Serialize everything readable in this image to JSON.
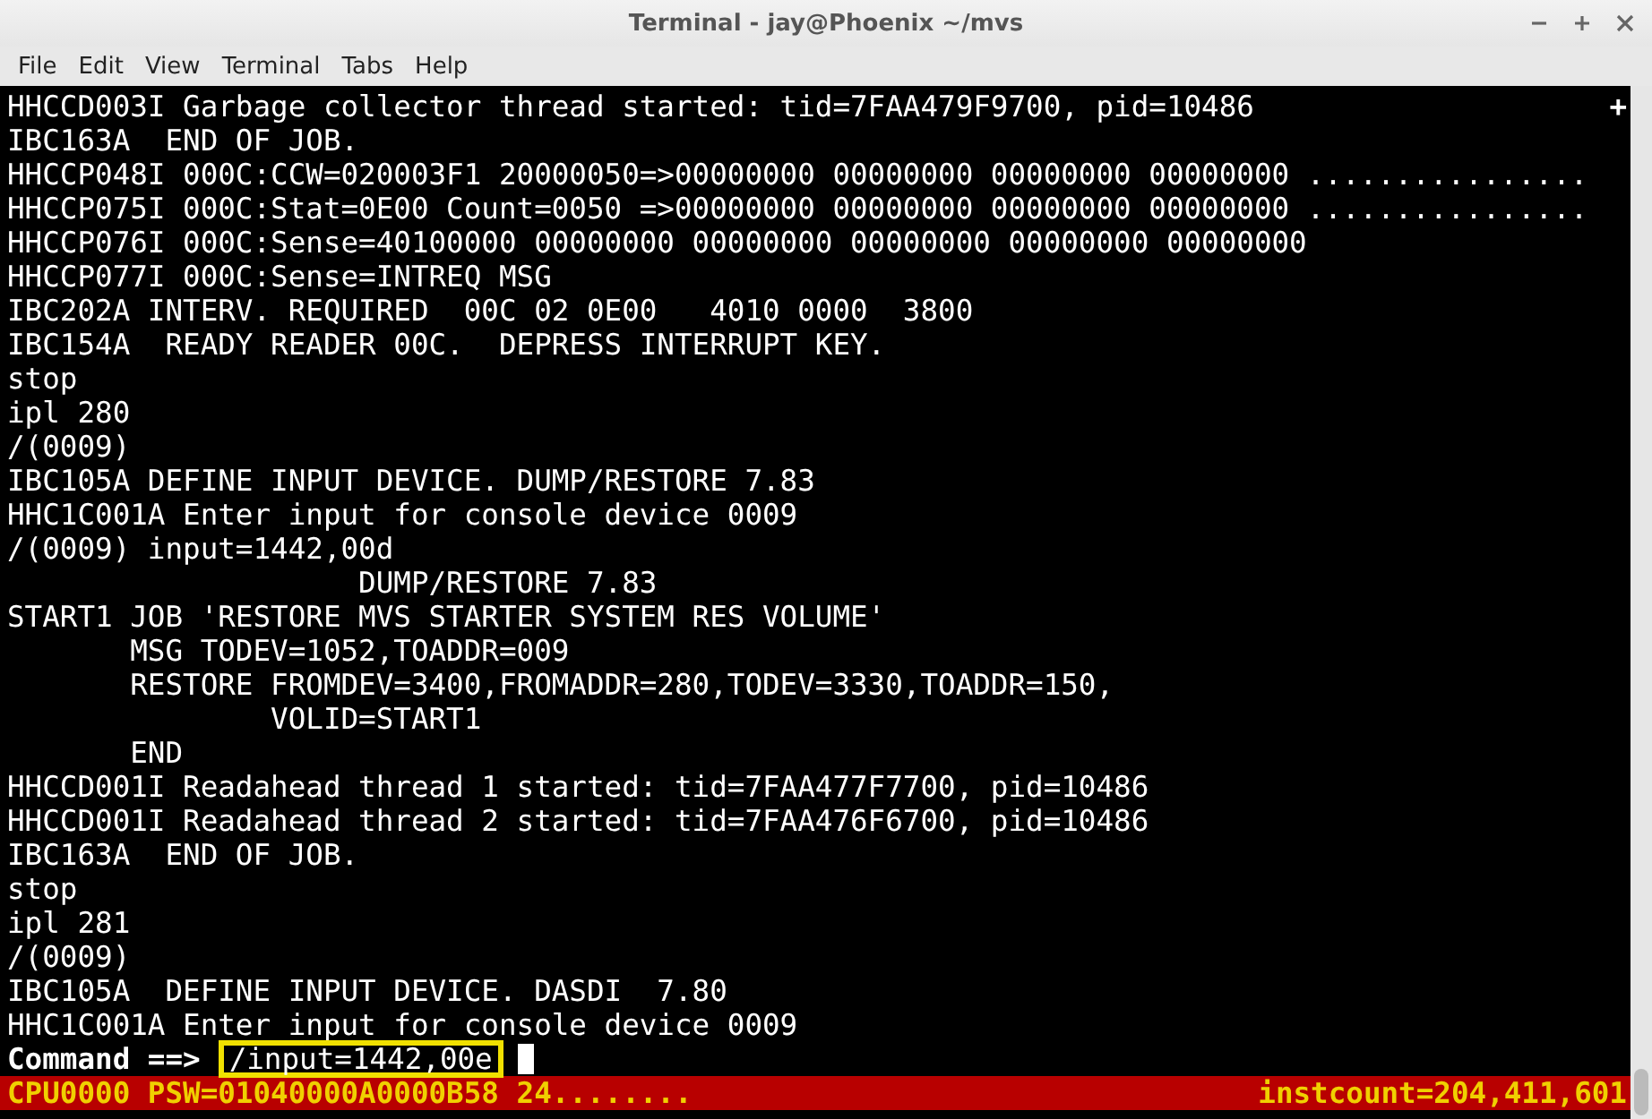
{
  "window": {
    "title": "Terminal - jay@Phoenix ~/mvs"
  },
  "menu": [
    "File",
    "Edit",
    "View",
    "Terminal",
    "Tabs",
    "Help"
  ],
  "terminal": {
    "marker": "+",
    "lines": [
      "HHCCD003I Garbage collector thread started: tid=7FAA479F9700, pid=10486",
      "IBC163A  END OF JOB.",
      "HHCCP048I 000C:CCW=020003F1 20000050=>00000000 00000000 00000000 00000000 ................",
      "HHCCP075I 000C:Stat=0E00 Count=0050 =>00000000 00000000 00000000 00000000 ................",
      "HHCCP076I 000C:Sense=40100000 00000000 00000000 00000000 00000000 00000000",
      "HHCCP077I 000C:Sense=INTREQ MSG",
      "IBC202A INTERV. REQUIRED  00C 02 0E00   4010 0000  3800",
      "IBC154A  READY READER 00C.  DEPRESS INTERRUPT KEY.",
      "stop",
      "ipl 280",
      "/(0009)",
      "IBC105A DEFINE INPUT DEVICE. DUMP/RESTORE 7.83",
      "HHC1C001A Enter input for console device 0009",
      "/(0009) input=1442,00d",
      "                    DUMP/RESTORE 7.83",
      "START1 JOB 'RESTORE MVS STARTER SYSTEM RES VOLUME'",
      "       MSG TODEV=1052,TOADDR=009",
      "       RESTORE FROMDEV=3400,FROMADDR=280,TODEV=3330,TOADDR=150,",
      "               VOLID=START1",
      "       END",
      "HHCCD001I Readahead thread 1 started: tid=7FAA477F7700, pid=10486",
      "HHCCD001I Readahead thread 2 started: tid=7FAA476F6700, pid=10486",
      "IBC163A  END OF JOB.",
      "stop",
      "ipl 281",
      "/(0009)",
      "IBC105A  DEFINE INPUT DEVICE. DASDI  7.80",
      "HHC1C001A Enter input for console device 0009"
    ],
    "prompt": "Command ==>",
    "input": "/input=1442,00e",
    "status_left": "CPU0000 PSW=01040000A0000B58 24........",
    "status_right": "instcount=204,411,601"
  }
}
